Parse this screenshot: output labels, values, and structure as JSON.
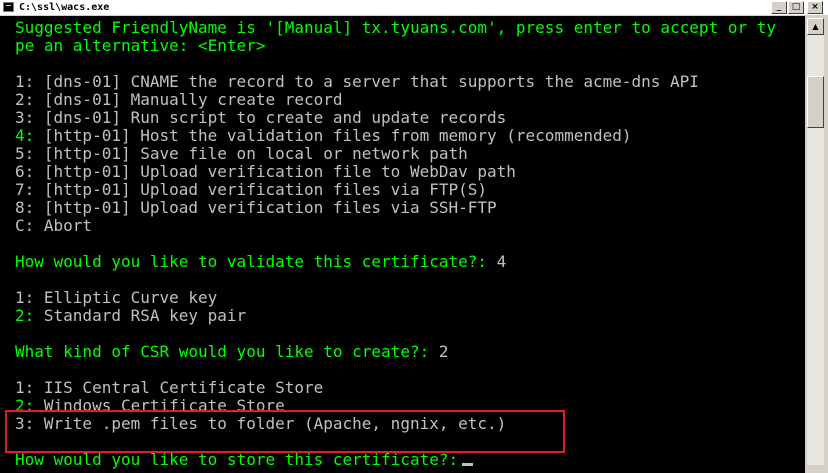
{
  "window": {
    "title": "C:\\ssl\\wacs.exe",
    "buttons": {
      "minimize": "_",
      "maximize": "□",
      "close": "×"
    }
  },
  "console": {
    "lines": [
      {
        "text": "Suggested FriendlyName is '[Manual] tx.tyuans.com', press enter to accept or ty",
        "color": "green"
      },
      {
        "text": "pe an alternative: <Enter>",
        "color": "green"
      },
      {
        "text": "",
        "color": "gray"
      },
      {
        "text": "1: [dns-01] CNAME the record to a server that supports the acme-dns API",
        "color": "gray"
      },
      {
        "text": "2: [dns-01] Manually create record",
        "color": "gray"
      },
      {
        "text": "3: [dns-01] Run script to create and update records",
        "color": "gray"
      },
      {
        "prefix": "4:",
        "rest": " [http-01] Host the validation files from memory (recommended)",
        "color": "mixed"
      },
      {
        "text": "5: [http-01] Save file on local or network path",
        "color": "gray"
      },
      {
        "text": "6: [http-01] Upload verification file to WebDav path",
        "color": "gray"
      },
      {
        "text": "7: [http-01] Upload verification files via FTP(S)",
        "color": "gray"
      },
      {
        "text": "8: [http-01] Upload verification files via SSH-FTP",
        "color": "gray"
      },
      {
        "text": "C: Abort",
        "color": "gray"
      },
      {
        "text": "",
        "color": "gray"
      },
      {
        "prompt": "How would you like to validate this certificate?:",
        "answer": " 4",
        "color": "prompt"
      },
      {
        "text": "",
        "color": "gray"
      },
      {
        "text": "1: Elliptic Curve key",
        "color": "gray"
      },
      {
        "prefix": "2:",
        "rest": " Standard RSA key pair",
        "color": "mixed"
      },
      {
        "text": "",
        "color": "gray"
      },
      {
        "prompt": "What kind of CSR would you like to create?:",
        "answer": " 2",
        "color": "prompt"
      },
      {
        "text": "",
        "color": "gray"
      },
      {
        "text": "1: IIS Central Certificate Store",
        "color": "gray"
      },
      {
        "prefix": "2:",
        "rest": " Windows Certificate Store",
        "color": "mixed"
      },
      {
        "text": "3: Write .pem files to folder (Apache, ngnix, etc.)",
        "color": "gray"
      },
      {
        "text": "",
        "color": "gray"
      },
      {
        "prompt": "How would you like to store this certificate?:",
        "answer": "",
        "color": "prompt"
      }
    ]
  },
  "colors": {
    "green": "#00ff00",
    "gray": "#c0c0c0",
    "highlight": "#e02020",
    "background": "#000000"
  }
}
